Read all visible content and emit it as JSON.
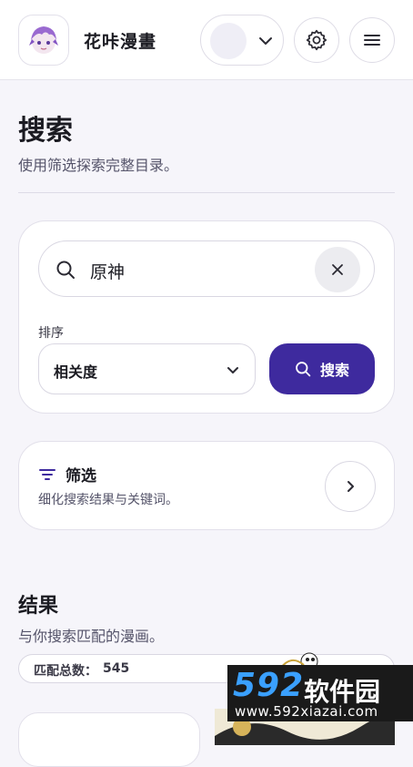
{
  "app": {
    "title": "花咔漫畫",
    "colors": {
      "accent": "#3e2a9e",
      "background": "#f6f5fa",
      "surface": "#ffffff"
    }
  },
  "header": {
    "settings_icon": "gear-icon",
    "menu_icon": "hamburger-menu-icon",
    "profile_chevron_icon": "chevron-down-icon"
  },
  "page": {
    "title": "搜索",
    "subtitle": "使用筛选探索完整目录。"
  },
  "search": {
    "query": "原神",
    "search_icon": "search-icon",
    "clear_icon": "close-icon",
    "sort_label": "排序",
    "sort_value": "相关度",
    "button_label": "搜索"
  },
  "filters": {
    "title": "筛选",
    "description": "细化搜索结果与关键词。",
    "icon": "filter-icon",
    "arrow_icon": "chevron-right-icon"
  },
  "results": {
    "title": "结果",
    "subtitle": "与你搜索匹配的漫画。",
    "match_label": "匹配总数：",
    "match_value": "545"
  },
  "watermark": {
    "brand_number": "592",
    "brand_name": "软件园",
    "url": "www.592xiazai.com"
  }
}
